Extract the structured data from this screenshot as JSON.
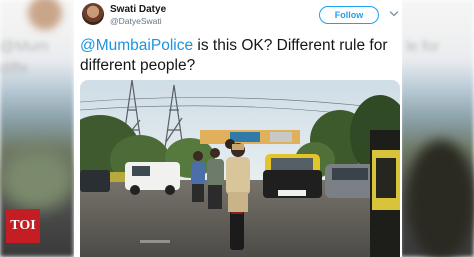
{
  "tweet": {
    "author_name": "Swati Datye",
    "author_handle": "@DatyeSwati",
    "follow_label": "Follow",
    "mention": "@MumbaiPolice",
    "text_rest": " is this OK? Different rule for different people?"
  },
  "backdrop": {
    "left_text": "@Mum",
    "left_text2": "diffe",
    "right_text": "le for"
  },
  "branding": {
    "logo_text": "TOI"
  },
  "colors": {
    "follow_blue": "#1da1f2",
    "mention_blue": "#1b95e0",
    "toi_red": "#c41e24"
  },
  "icons": {
    "menu": "chevron-down-icon"
  }
}
